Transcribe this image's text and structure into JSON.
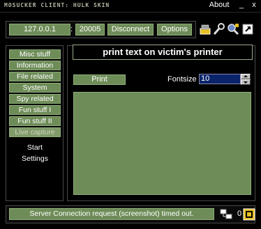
{
  "titlebar": {
    "app_title": "MOSUCKER CLIENT: HULK SKIN",
    "about_label": "About",
    "minimize_label": "_",
    "close_label": "x"
  },
  "connection": {
    "ip": "127.0.0.1",
    "separator": ":",
    "port": "20005",
    "disconnect_label": "Disconnect",
    "options_label": "Options"
  },
  "sidebar": {
    "items": [
      {
        "label": "Misc stuff"
      },
      {
        "label": "Information"
      },
      {
        "label": "File related"
      },
      {
        "label": "System"
      },
      {
        "label": "Spy related"
      },
      {
        "label": "Fun stuff I"
      },
      {
        "label": "Fun stuff II"
      },
      {
        "label": "Live capture"
      }
    ],
    "start_label": "Start",
    "settings_label": "Settings"
  },
  "main": {
    "heading": "print text on victim's printer",
    "print_label": "Print",
    "fontsize_label": "Fontsize",
    "fontsize_value": "10",
    "text_value": ""
  },
  "status": {
    "message": "Server Connection request (screenshot) timed out.",
    "count": "0"
  },
  "colors": {
    "accent_green": "#6e8c58",
    "border_green": "#8fae78",
    "background": "#000000",
    "selection_blue": "#0a246a"
  }
}
